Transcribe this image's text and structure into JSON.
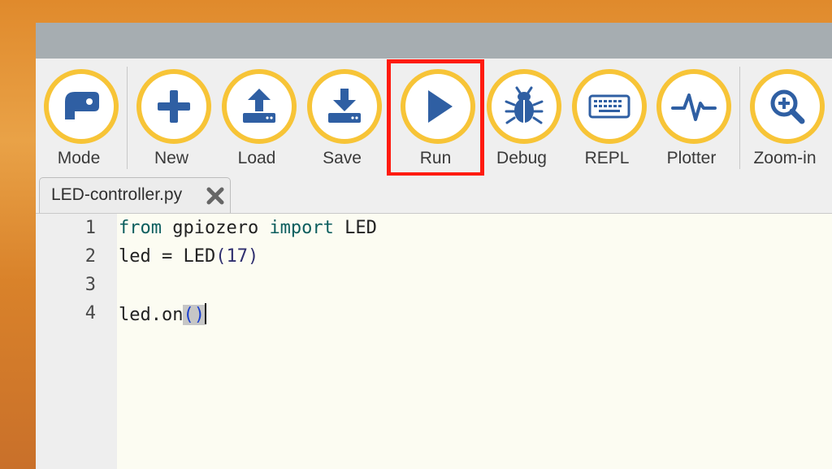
{
  "toolbar": {
    "buttons": [
      {
        "id": "mode",
        "label": "Mode",
        "icon": "mode-icon"
      },
      {
        "id": "new",
        "label": "New",
        "icon": "plus-icon"
      },
      {
        "id": "load",
        "label": "Load",
        "icon": "upload-icon"
      },
      {
        "id": "save",
        "label": "Save",
        "icon": "download-icon"
      },
      {
        "id": "run",
        "label": "Run",
        "icon": "play-icon"
      },
      {
        "id": "debug",
        "label": "Debug",
        "icon": "bug-icon"
      },
      {
        "id": "repl",
        "label": "REPL",
        "icon": "keyboard-icon"
      },
      {
        "id": "plotter",
        "label": "Plotter",
        "icon": "pulse-icon"
      },
      {
        "id": "zoom_in",
        "label": "Zoom-in",
        "icon": "zoom-in-icon"
      }
    ],
    "highlighted": "run"
  },
  "tabs": [
    {
      "label": "LED-controller.py",
      "close_icon": "close-icon"
    }
  ],
  "editor": {
    "lines": [
      {
        "number": "1",
        "tokens": [
          "from",
          " gpiozero ",
          "import",
          " LED"
        ]
      },
      {
        "number": "2",
        "tokens": [
          "led = LED",
          "(",
          "17",
          ")"
        ]
      },
      {
        "number": "3",
        "tokens": []
      },
      {
        "number": "4",
        "tokens": [
          "led.on",
          "()"
        ]
      }
    ]
  },
  "colors": {
    "button_ring": "#f7c437",
    "icon": "#2f5fa3",
    "highlight_box": "#ff1b10",
    "editor_bg": "#fcfcf2"
  }
}
